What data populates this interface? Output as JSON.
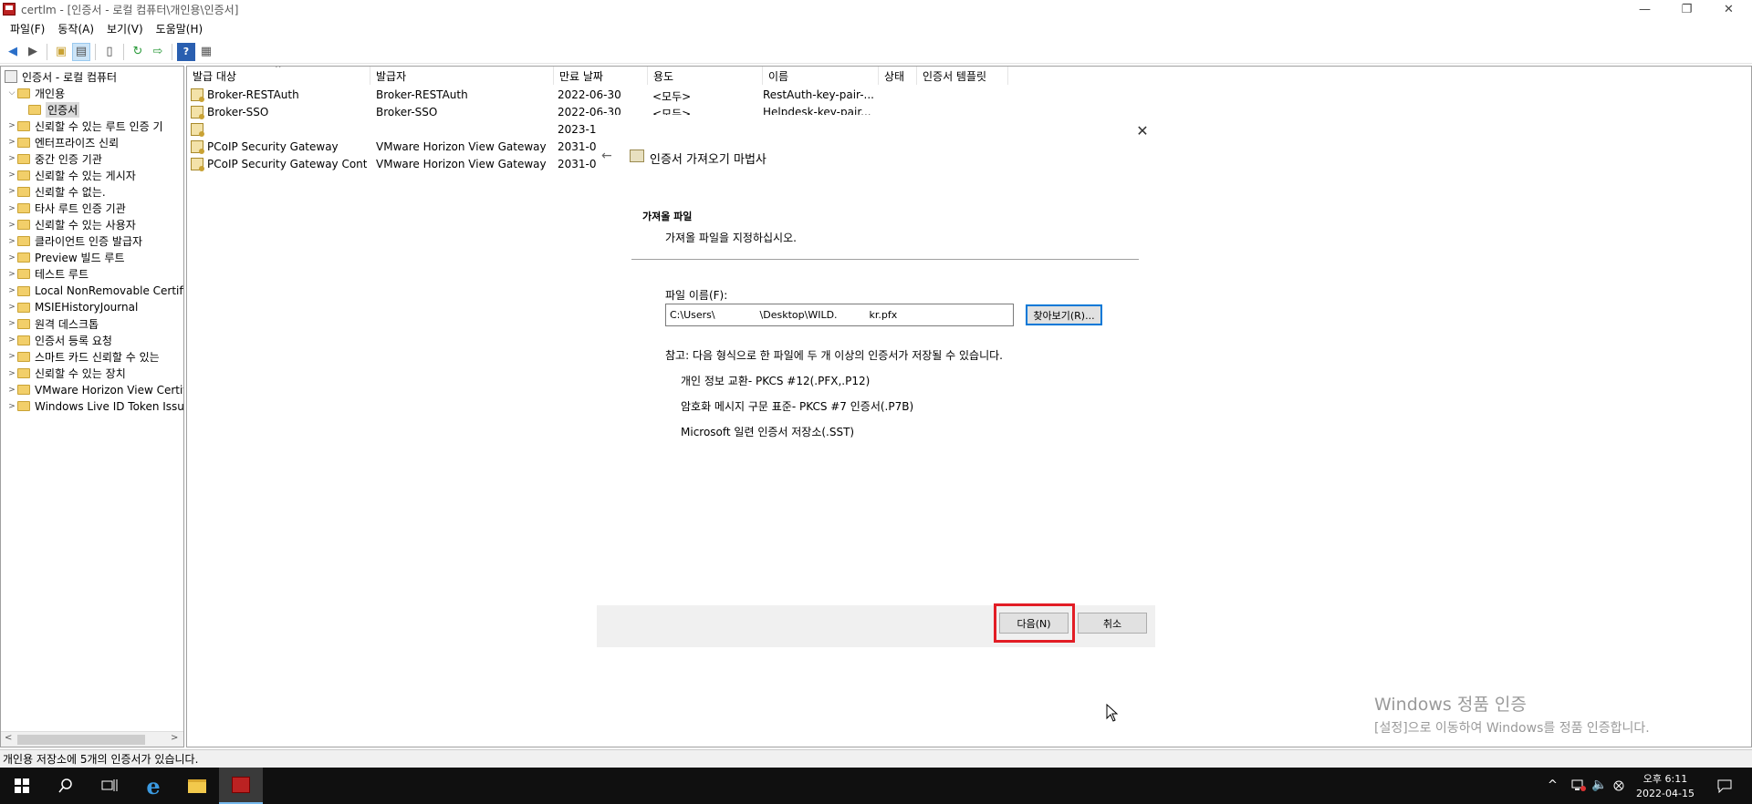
{
  "window": {
    "title": "certlm - [인증서 - 로컬 컴퓨터\\개인용\\인증서]",
    "minimize_glyph": "—",
    "restore_glyph": "❐",
    "close_glyph": "✕"
  },
  "menu": [
    "파일(F)",
    "동작(A)",
    "보기(V)",
    "도움말(H)"
  ],
  "toolbar_icons": [
    "back-arrow-icon",
    "forward-arrow-icon",
    "up-folder-icon",
    "show-tree-icon",
    "delete-icon",
    "refresh-icon",
    "export-icon",
    "help-icon",
    "properties-icon"
  ],
  "tree": {
    "root": "인증서 - 로컬 컴퓨터",
    "personal": "개인용",
    "certificates": "인증서",
    "stores": [
      "신뢰할 수 있는 루트 인증 기",
      "엔터프라이즈 신뢰",
      "중간 인증 기관",
      "신뢰할 수 있는 게시자",
      "신뢰할 수 없는.",
      "타사 루트 인증 기관",
      "신뢰할 수 있는 사용자",
      "클라이언트 인증 발급자",
      "Preview 빌드 루트",
      "테스트 루트",
      "Local NonRemovable Certific",
      "MSIEHistoryJournal",
      "원격 데스크톱",
      "인증서 등록 요청",
      "스마트 카드 신뢰할 수 있는",
      "신뢰할 수 있는 장치",
      "VMware Horizon View Certifi",
      "Windows Live ID Token Issue"
    ]
  },
  "list": {
    "columns": [
      "발급 대상",
      "발급자",
      "만료 날짜",
      "용도",
      "이름",
      "상태",
      "인증서 템플릿"
    ],
    "rows": [
      {
        "subject": "Broker-RESTAuth",
        "issuer": "Broker-RESTAuth",
        "expires": "2022-06-30",
        "purpose": "<모두>",
        "name": "RestAuth-key-pair-..."
      },
      {
        "subject": "Broker-SSO",
        "issuer": "Broker-SSO",
        "expires": "2022-06-30",
        "purpose": "<모두>",
        "name": "Helpdesk-key-pair..."
      },
      {
        "subject": "",
        "issuer": "",
        "expires": "2023-1(",
        "purpose": "",
        "name": ""
      },
      {
        "subject": "PCoIP Security Gateway",
        "issuer": "VMware Horizon View Gateway ...",
        "expires": "2031-0(",
        "purpose": "",
        "name": ""
      },
      {
        "subject": "PCoIP Security Gateway Contr...",
        "issuer": "VMware Horizon View Gateway ...",
        "expires": "2031-0(",
        "purpose": "",
        "name": ""
      }
    ]
  },
  "wizard": {
    "title": "인증서 가져오기 마법사",
    "section_title": "가져올 파일",
    "section_desc": "가져올 파일을 지정하십시오.",
    "file_label": "파일 이름(F):",
    "file_value": "C:\\Users\\              \\Desktop\\WILD.          kr.pfx",
    "browse_label": "찾아보기(R)...",
    "note": "참고: 다음 형식으로 한 파일에 두 개 이상의 인증서가 저장될 수 있습니다.",
    "formats": [
      "개인 정보 교환- PKCS #12(.PFX,.P12)",
      "암호화 메시지 구문 표준- PKCS #7 인증서(.P7B)",
      "Microsoft 일련 인증서 저장소(.SST)"
    ],
    "next_label": "다음(N)",
    "cancel_label": "취소",
    "close_glyph": "✕",
    "back_glyph": "←"
  },
  "watermark": {
    "title": "Windows 정품 인증",
    "subtitle": "[설정]으로 이동하여 Windows를 정품 인증합니다."
  },
  "status": "개인용 저장소에 5개의 인증서가 있습니다.",
  "taskbar": {
    "time": "오후 6:11",
    "date": "2022-04-15",
    "tray_up_glyph": "^"
  },
  "colors": {
    "highlight": "#e21d25",
    "accent": "#0078d7"
  }
}
